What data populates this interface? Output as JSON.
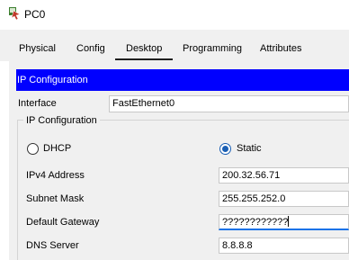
{
  "window": {
    "title": "PC0",
    "icon": "packet-tracer-pc-icon"
  },
  "tabs": [
    {
      "label": "Physical",
      "active": false
    },
    {
      "label": "Config",
      "active": false
    },
    {
      "label": "Desktop",
      "active": true
    },
    {
      "label": "Programming",
      "active": false
    },
    {
      "label": "Attributes",
      "active": false
    }
  ],
  "panel": {
    "header": "IP Configuration",
    "header_color": "#0000ff",
    "interface_label": "Interface",
    "interface_value": "FastEthernet0",
    "group_title": "IP Configuration",
    "dhcp_label": "DHCP",
    "static_label": "Static",
    "selected_mode": "Static",
    "fields": [
      {
        "label": "IPv4 Address",
        "value": "200.32.56.71"
      },
      {
        "label": "Subnet Mask",
        "value": "255.255.252.0"
      },
      {
        "label": "Default Gateway",
        "value": "????????????"
      },
      {
        "label": "DNS Server",
        "value": "8.8.8.8"
      }
    ]
  }
}
